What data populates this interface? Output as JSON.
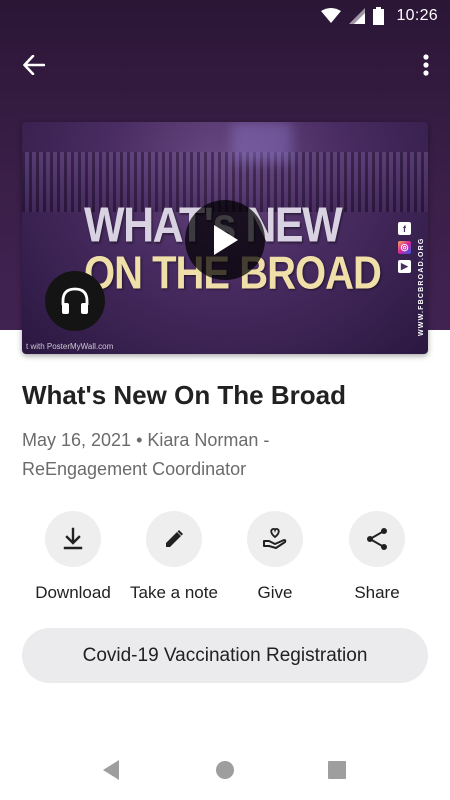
{
  "status_bar": {
    "time": "10:26"
  },
  "episode": {
    "title": "What's New On The Broad",
    "meta_line1": "May 16, 2021 • Kiara Norman -",
    "meta_line2": "ReEngagement Coordinator"
  },
  "thumbnail": {
    "line1": "WHAT's NEW",
    "line2": "ON THE BROAD",
    "url": "WWW.FBCBROAD.ORG",
    "watermark": "t with PosterMyWall.com"
  },
  "actions": [
    {
      "label": "Download",
      "icon": "download-icon"
    },
    {
      "label": "Take a note",
      "icon": "pencil-icon"
    },
    {
      "label": "Give",
      "icon": "give-hand-heart-icon"
    },
    {
      "label": "Share",
      "icon": "share-icon"
    }
  ],
  "cta": {
    "label": "Covid-19 Vaccination Registration"
  },
  "colors": {
    "header_bg": "#3a1f48",
    "text_primary": "#212121",
    "text_secondary": "#6b6b6b",
    "button_bg": "#ebebed"
  }
}
